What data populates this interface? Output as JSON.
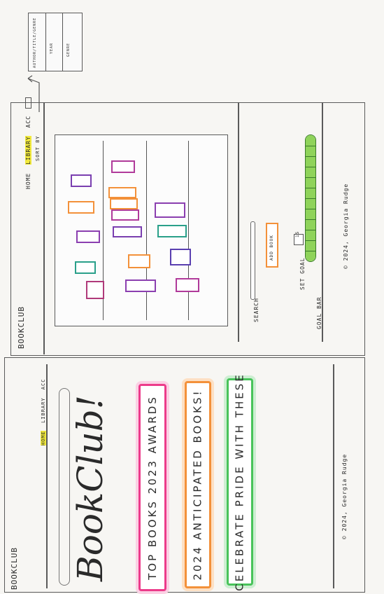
{
  "library": {
    "site_name": "BOOKCLUB",
    "nav": [
      "HOME",
      "LIBRARY",
      "ACC"
    ],
    "sort_label": "SORT BY",
    "dropdown_items": [
      "AUTHOR/TITLE/GENRE",
      "YEAR",
      "GENRE"
    ],
    "search_label": "SEARCH",
    "add_book_label": "ADD BOOK",
    "set_goal_label": "SET GOAL",
    "goal_value": "15",
    "goal_bar_label": "GOAL BAR",
    "goal_progress": 1.0,
    "footer": "© 2024, Georgia Rudge",
    "colors": {
      "nav_highlight": "#f2ea3c",
      "goal_bar": "#8fd35a"
    }
  },
  "home": {
    "site_name": "BOOKCLUB",
    "nav": [
      "HOME",
      "LIBRARY",
      "ACC"
    ],
    "hero_title": "BookClub!",
    "banners": [
      {
        "label": "TOP BOOKS 2023 AWARDS",
        "color": "#ec3b8a"
      },
      {
        "label": "2024 ANTICIPATED BOOKS!",
        "color": "#f3913a"
      },
      {
        "label": "CELEBRATE PRIDE WITH THESE",
        "color": "#48c35a"
      }
    ],
    "footer": "© 2024, Georgia Rudge"
  }
}
